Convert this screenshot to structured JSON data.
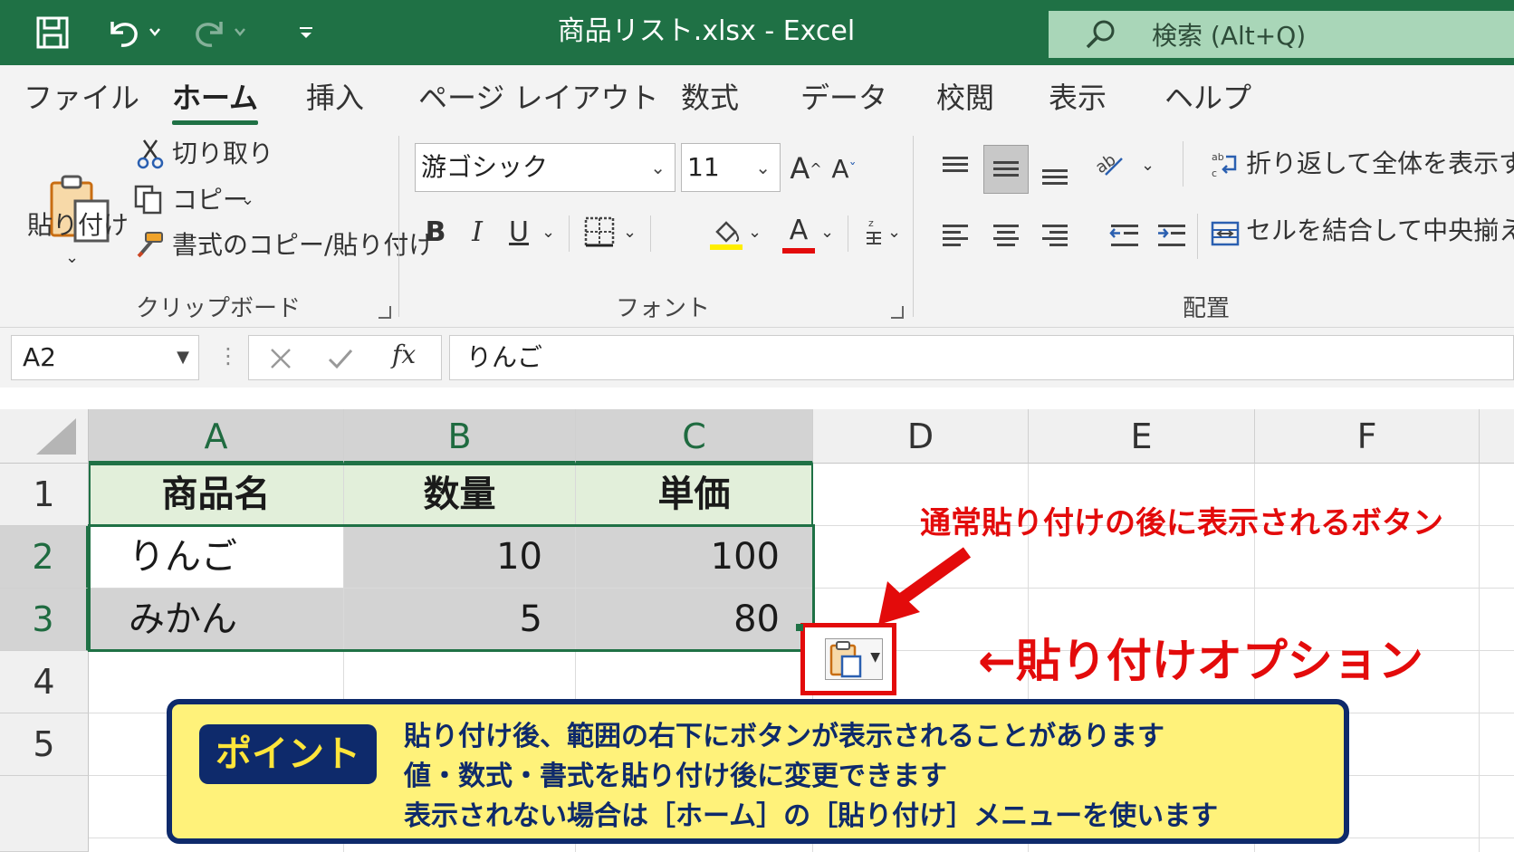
{
  "titlebar": {
    "title": "商品リスト.xlsx  -  Excel",
    "search_placeholder": "検索 (Alt+Q)",
    "icons": [
      "save-icon",
      "undo-icon",
      "redo-icon",
      "customize-icon",
      "search-icon"
    ]
  },
  "tabs": [
    "ファイル",
    "ホーム",
    "挿入",
    "ページ レイアウト",
    "数式",
    "データ",
    "校閲",
    "表示",
    "ヘルプ"
  ],
  "ribbon": {
    "clipboard": {
      "paste": "貼り付け",
      "cut": "切り取り",
      "copy": "コピー",
      "format_painter": "書式のコピー/貼り付け",
      "label": "クリップボード"
    },
    "font": {
      "font_name": "游ゴシック",
      "font_size": "11",
      "bold": "B",
      "italic": "I",
      "underline": "U",
      "font_color": "A",
      "label": "フォント"
    },
    "alignment": {
      "wrap_text": "折り返して全体を表示する",
      "merge_center": "セルを結合して中央揃え",
      "label": "配置"
    }
  },
  "formula_bar": {
    "name_box": "A2",
    "fx": "fx",
    "content": "りんご"
  },
  "sheet": {
    "columns": [
      "A",
      "B",
      "C",
      "D",
      "E",
      "F"
    ],
    "rows": [
      "1",
      "2",
      "3",
      "4",
      "5"
    ],
    "header": [
      "商品名",
      "数量",
      "単価"
    ],
    "data": [
      [
        "りんご",
        "10",
        "100"
      ],
      [
        "みかん",
        "5",
        "80"
      ]
    ]
  },
  "callouts": {
    "button_caption": "通常貼り付けの後に表示されるボタン",
    "paste_options": "←貼り付けオプション",
    "point_badge": "ポイント",
    "point_lines": [
      "貼り付け後、範囲の右下にボタンが表示されることがあります",
      "値・数式・書式を貼り付け後に変更できます",
      "表示されない場合は［ホーム］の［貼り付け］メニューを使います"
    ]
  },
  "colors": {
    "excel_green": "#1f7145",
    "header_fill": "#e2efda",
    "callout_red": "#e30b0b",
    "point_yellow": "#fff27a",
    "point_navy": "#0e2a6b"
  }
}
